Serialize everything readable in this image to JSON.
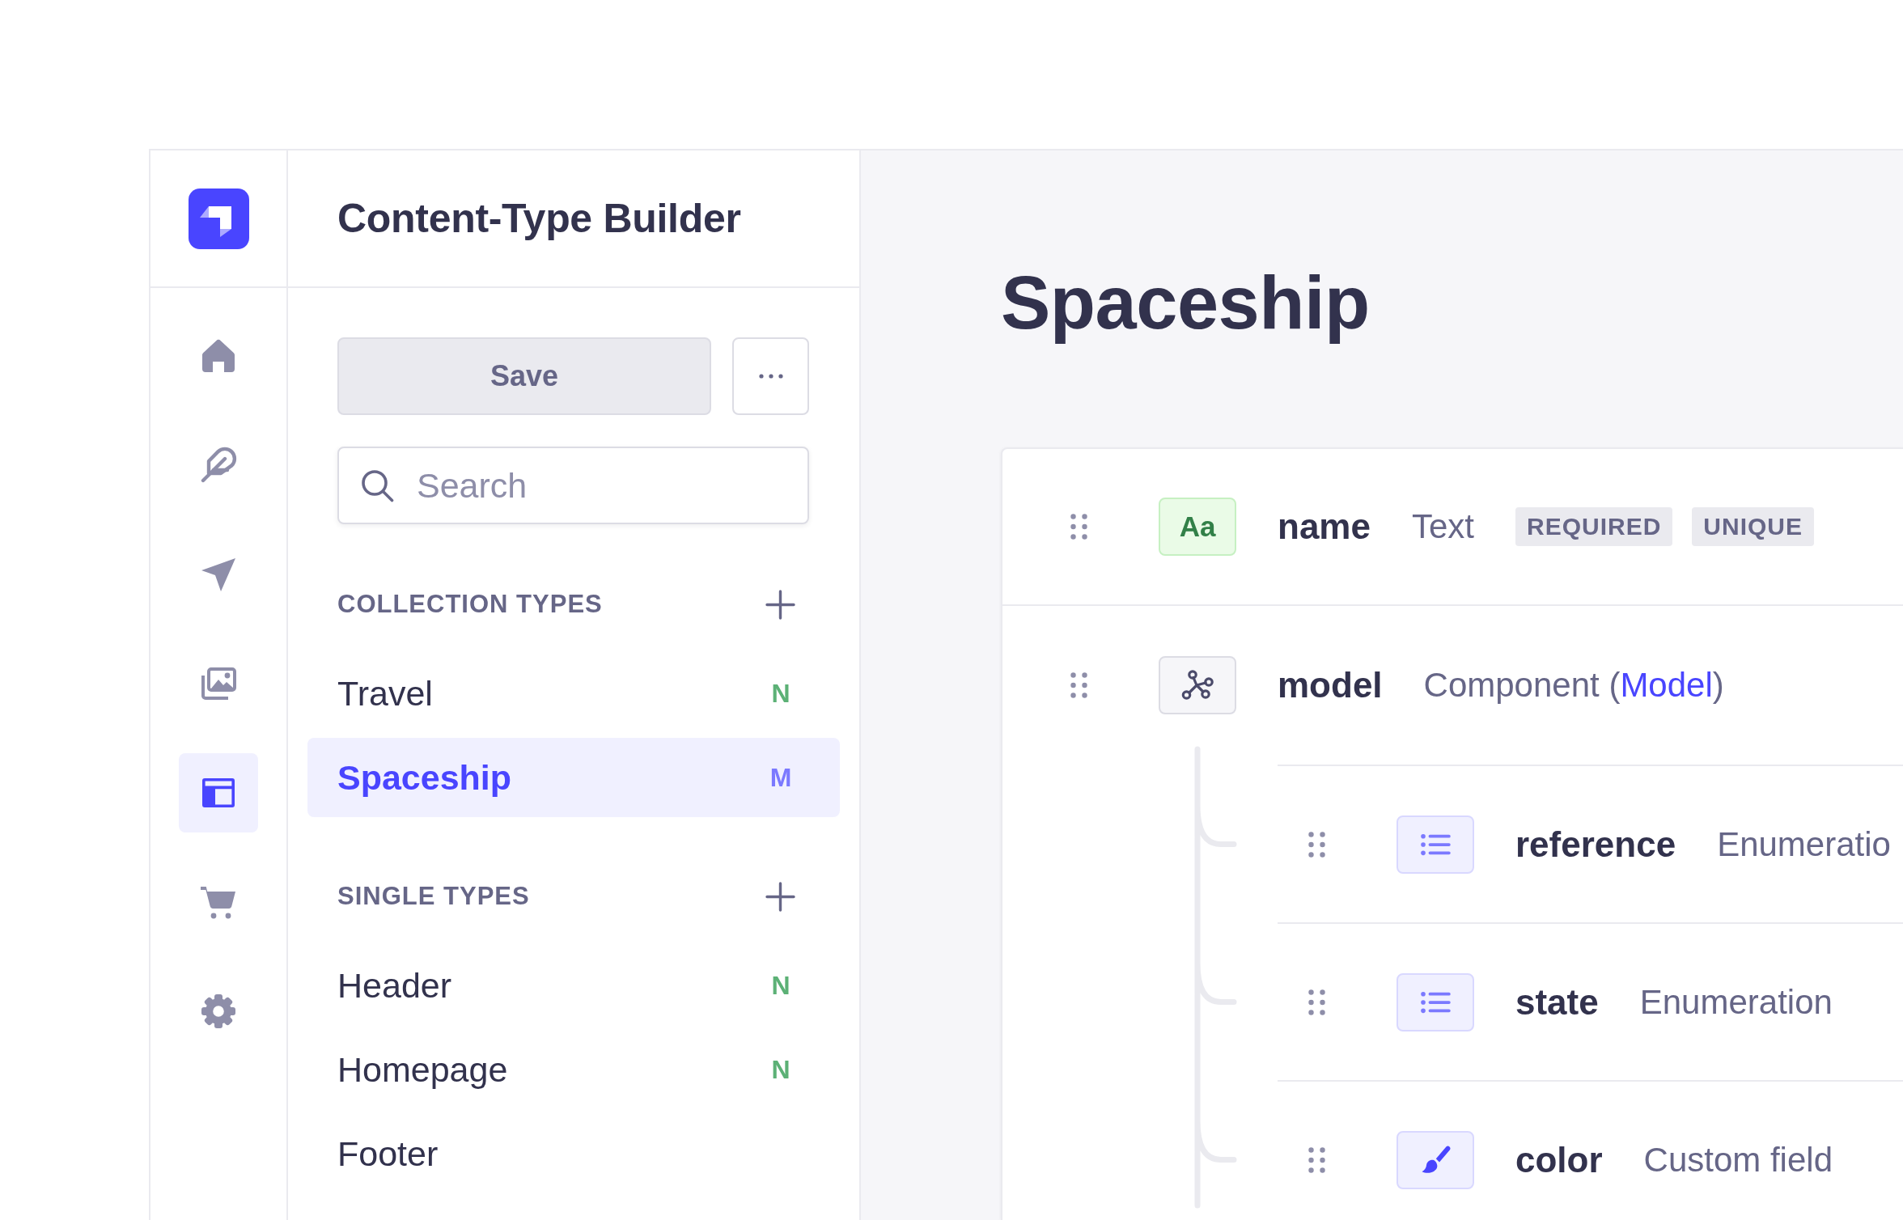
{
  "nav_rail": {
    "items": [
      {
        "kind": "home",
        "selected": false
      },
      {
        "kind": "feather",
        "selected": false
      },
      {
        "kind": "send",
        "selected": false
      },
      {
        "kind": "media",
        "selected": false
      },
      {
        "kind": "builder",
        "selected": true
      },
      {
        "kind": "cart",
        "selected": false
      },
      {
        "kind": "settings",
        "selected": false
      }
    ]
  },
  "sidebar": {
    "title": "Content-Type Builder",
    "save_button": {
      "label": "Save",
      "disabled": true
    },
    "search": {
      "placeholder": "Search"
    },
    "sections": [
      {
        "title": "COLLECTION TYPES",
        "items": [
          {
            "label": "Travel",
            "status": "N",
            "color": "#5cb176",
            "selected": false
          },
          {
            "label": "Spaceship",
            "status": "M",
            "color": "#7b79ff",
            "selected": true
          }
        ]
      },
      {
        "title": "SINGLE TYPES",
        "items": [
          {
            "label": "Header",
            "status": "N",
            "color": "#5cb176",
            "selected": false
          },
          {
            "label": "Homepage",
            "status": "N",
            "color": "#5cb176",
            "selected": false
          },
          {
            "label": "Footer",
            "selected": false
          }
        ]
      }
    ]
  },
  "main": {
    "title": "Spaceship",
    "fields": [
      {
        "kind": "text",
        "icon_text": "Aa",
        "name": "name",
        "type": "Text",
        "tags": [
          "REQUIRED",
          "UNIQUE"
        ]
      },
      {
        "kind": "component",
        "name": "model",
        "type": "Component (",
        "link": "Model",
        "type_end": ")",
        "children": [
          {
            "kind": "enumeration",
            "name": "reference",
            "type": "Enumeratio"
          },
          {
            "kind": "enumeration",
            "name": "state",
            "type": "Enumeration"
          },
          {
            "kind": "custom",
            "name": "color",
            "type": "Custom field"
          }
        ]
      }
    ]
  }
}
